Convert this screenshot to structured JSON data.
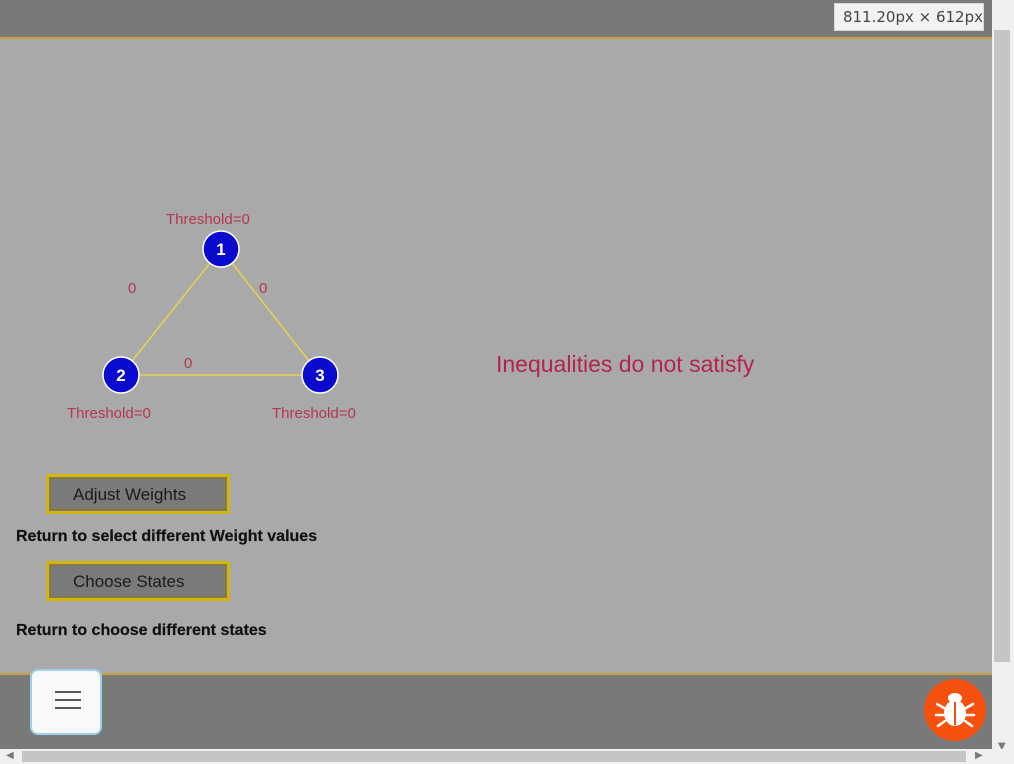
{
  "viewport_size_tip": "811.20px × 612px",
  "graph": {
    "nodes": [
      {
        "label": "1",
        "threshold": "Threshold=0"
      },
      {
        "label": "2",
        "threshold": "Threshold=0"
      },
      {
        "label": "3",
        "threshold": "Threshold=0"
      }
    ],
    "weights": {
      "w12": "0",
      "w13": "0",
      "w23": "0"
    }
  },
  "result_message": "Inequalities do not satisfy",
  "actions": {
    "adjust_weights_label": "Adjust Weights",
    "adjust_weights_note": "Return to select different Weight values",
    "choose_states_label": "Choose States",
    "choose_states_note": "Return to choose different states"
  },
  "colors": {
    "background": "#a9a9a9",
    "bars": "#797979",
    "accent_gold": "#d4b50b",
    "node_blue": "#0b0bcf",
    "label_red": "#b3374f",
    "bug_orange": "#f5500d"
  },
  "icons": {
    "menu": "hamburger-icon",
    "debug": "bug-icon"
  }
}
